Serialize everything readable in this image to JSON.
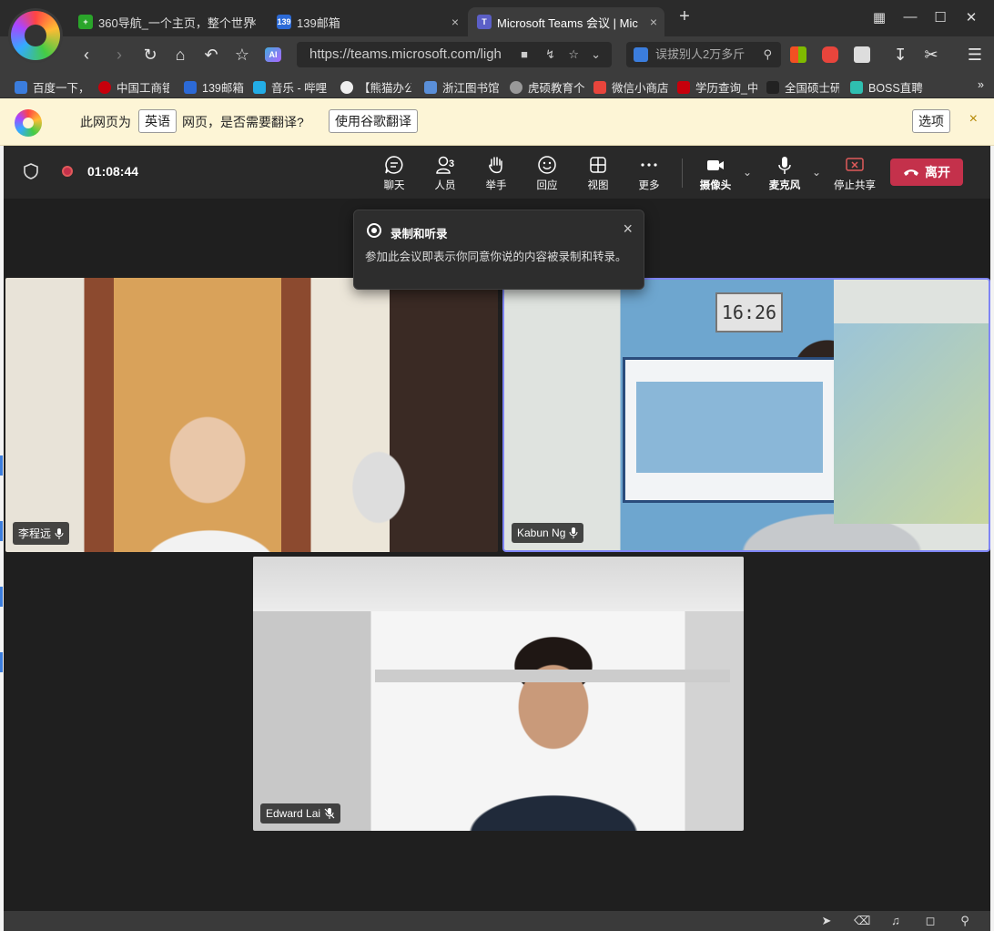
{
  "browser": {
    "tabs": [
      {
        "title": "360导航_一个主页，整个世界",
        "close": "×"
      },
      {
        "title": "139邮箱",
        "close": "×"
      },
      {
        "title": "Microsoft Teams 会议 | Mic",
        "close": "×"
      }
    ],
    "new_tab": "+",
    "url": "https://teams.microsoft.com/ligh",
    "search_placeholder": "误拔别人2万多斤",
    "ai_label": "AI",
    "bookmarks": [
      "百度一下，",
      "中国工商银",
      "139邮箱",
      "音乐 - 哔哩",
      "【熊猫办公",
      "浙江图书馆",
      "虎硕教育个",
      "微信小商店",
      "学历查询_中",
      "全国硕士研",
      "BOSS直聘"
    ],
    "bookmarks_more": "»",
    "colors": {
      "tabbar": "#2b2b2b",
      "toolbar": "#3c3c3c",
      "translate_bg": "#fdf5d6"
    }
  },
  "translate": {
    "prefix": "此网页为",
    "language": "英语",
    "question": "网页，是否需要翻译?",
    "translate_button": "使用谷歌翻译",
    "options_button": "选项",
    "close": "×"
  },
  "teams": {
    "timer": "01:08:44",
    "controls": {
      "chat": "聊天",
      "people": "人员",
      "people_count": "3",
      "raise_hand": "举手",
      "react": "回应",
      "view": "视图",
      "more": "更多",
      "camera": "摄像头",
      "mic": "麦克风",
      "stop_share": "停止共享",
      "leave": "离开"
    },
    "recording_popup": {
      "title": "录制和听录",
      "body": "参加此会议即表示你同意你说的内容被录制和转录。",
      "close": "×"
    },
    "participants": [
      {
        "name": "李程远",
        "muted": false
      },
      {
        "name": "Kabun Ng",
        "muted": false
      },
      {
        "name": "Edward Lai",
        "muted": true
      }
    ],
    "clock_display": "16:26",
    "colors": {
      "leave": "#c4314b",
      "active_speaker": "#7f85f5",
      "stage": "#1f1f1f"
    }
  }
}
